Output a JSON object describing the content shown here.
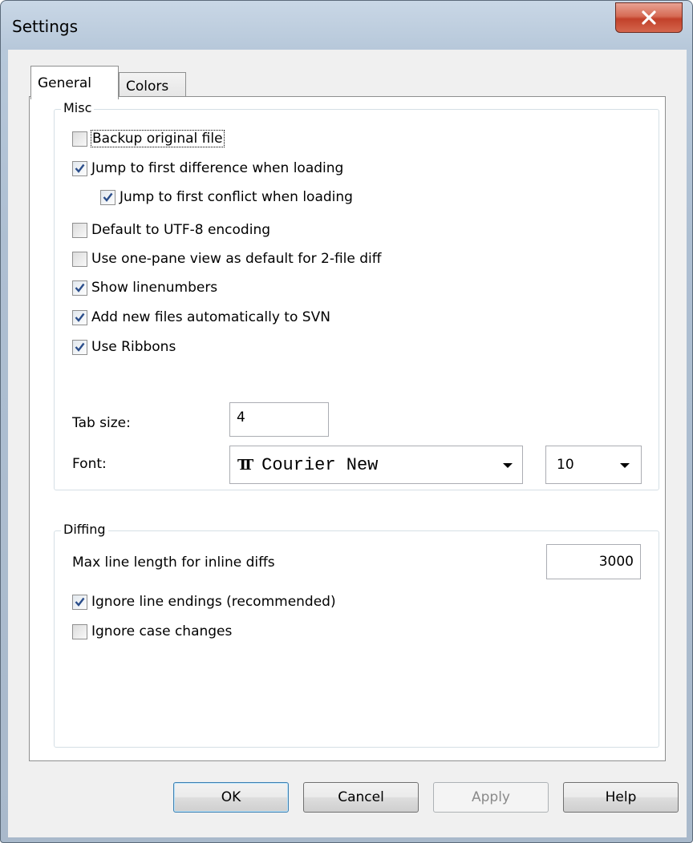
{
  "window": {
    "title": "Settings",
    "close_glyph": "X"
  },
  "tabs": [
    {
      "label": "General",
      "selected": true
    },
    {
      "label": "Colors",
      "selected": false
    }
  ],
  "misc": {
    "title": "Misc",
    "checkboxes": [
      {
        "label": "Backup original file",
        "checked": false
      },
      {
        "label": "Jump to first difference when loading",
        "checked": true
      },
      {
        "label": "Jump to first conflict when loading",
        "checked": true
      },
      {
        "label": "Default to UTF-8 encoding",
        "checked": false
      },
      {
        "label": "Use one-pane view as default for 2-file diff",
        "checked": false
      },
      {
        "label": "Show linenumbers",
        "checked": true
      },
      {
        "label": "Add new files automatically to SVN",
        "checked": true
      },
      {
        "label": "Use Ribbons",
        "checked": true
      }
    ],
    "tab_size_label": "Tab size:",
    "tab_size_value": "4",
    "font_label": "Font:",
    "font_value": "Courier New",
    "font_icon": "truetype-font-icon",
    "font_size_value": "10"
  },
  "diffing": {
    "title": "Diffing",
    "max_line_label": "Max line length for inline diffs",
    "max_line_value": "3000",
    "checkboxes": [
      {
        "label": "Ignore line endings (recommended)",
        "checked": true
      },
      {
        "label": "Ignore case changes",
        "checked": false
      }
    ]
  },
  "buttons": {
    "ok": "OK",
    "cancel": "Cancel",
    "apply": "Apply",
    "help": "Help"
  }
}
